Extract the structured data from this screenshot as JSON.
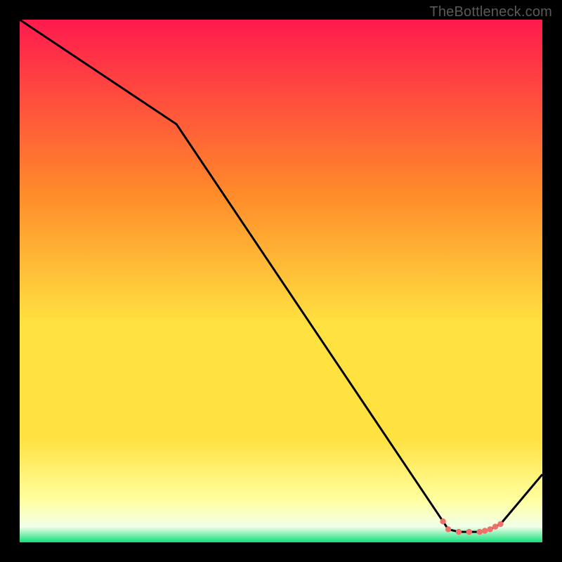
{
  "attribution": "TheBottleneck.com",
  "colors": {
    "bg": "#000000",
    "attribution_text": "#5a5a5a",
    "curve": "#000000",
    "dot": "#ef6f6b",
    "grad_top": "#ff1a4e",
    "grad_mid_upper": "#ff8a2a",
    "grad_mid": "#ffe140",
    "grad_low": "#ffffa0",
    "grad_band_light": "#f2ffe9",
    "grad_bottom": "#12e07c"
  },
  "chart_data": {
    "type": "line",
    "title": "",
    "xlabel": "",
    "ylabel": "",
    "xlim": [
      0,
      100
    ],
    "ylim": [
      0,
      100
    ],
    "grid": false,
    "series": [
      {
        "name": "curve",
        "x": [
          0,
          30,
          81,
          82,
          84,
          86,
          88,
          89,
          90,
          91,
          92,
          100
        ],
        "values": [
          100,
          80,
          4,
          2.5,
          2,
          2,
          2,
          2.2,
          2.5,
          3,
          3.5,
          13
        ]
      }
    ],
    "flat_region": {
      "x": [
        81,
        82,
        84,
        86,
        88,
        89,
        90,
        91,
        92
      ],
      "values": [
        4,
        2.5,
        2,
        2,
        2,
        2.2,
        2.5,
        3,
        3.5
      ]
    }
  }
}
